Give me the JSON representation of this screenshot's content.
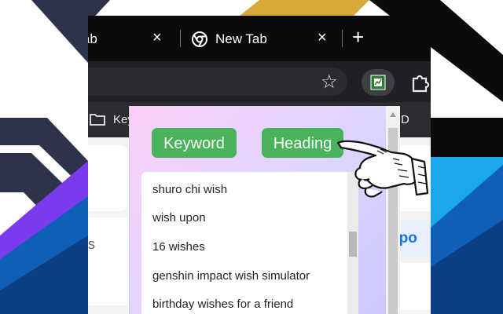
{
  "tabs": [
    {
      "label": "New Tab"
    },
    {
      "label": "New Tab"
    }
  ],
  "icons": {
    "close": "×",
    "plus": "+",
    "star": "☆"
  },
  "bookmark_label": "Key",
  "bookmark_right": "D",
  "content_snips": {
    "left": "s",
    "right": "npo"
  },
  "popup": {
    "keyword_button": "Keyword",
    "heading_button": "Heading",
    "suggestions": [
      "shuro chi wish",
      "wish upon",
      "16 wishes",
      "genshin impact wish simulator",
      "birthday wishes for a friend"
    ]
  },
  "colors": {
    "button_green": "#49b25b",
    "tabbar_dark": "#0b0b0b",
    "accent_blue": "#1a73e8"
  }
}
